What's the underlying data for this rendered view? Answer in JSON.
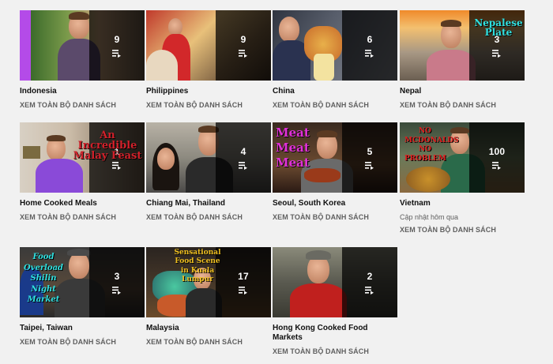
{
  "playlists": [
    {
      "title": "Indonesia",
      "count": "9",
      "action": "XEM TOÀN BỘ DANH SÁCH"
    },
    {
      "title": "Philippines",
      "count": "9",
      "action": "XEM TOÀN BỘ DANH SÁCH"
    },
    {
      "title": "China",
      "count": "6",
      "action": "XEM TOÀN BỘ DANH SÁCH"
    },
    {
      "title": "Nepal",
      "count": "3",
      "action": "XEM TOÀN BỘ DANH SÁCH",
      "overlay_text": "Nepalese Plate"
    },
    {
      "title": "Home Cooked Meals",
      "count": "1",
      "action": "XEM TOÀN BỘ DANH SÁCH",
      "overlay_text": "An Incredible Malay Feast"
    },
    {
      "title": "Chiang Mai, Thailand",
      "count": "4",
      "action": "XEM TOÀN BỘ DANH SÁCH"
    },
    {
      "title": "Seoul, South Korea",
      "count": "5",
      "action": "XEM TOÀN BỘ DANH SÁCH",
      "overlay_text": "Meat Meat Meat"
    },
    {
      "title": "Vietnam",
      "count": "100",
      "subtitle": "Cập nhật hôm qua",
      "action": "XEM TOÀN BỘ DANH SÁCH",
      "overlay_text": "NO MCDONALDS NO PROBLEM"
    },
    {
      "title": "Taipei, Taiwan",
      "count": "3",
      "action": "XEM TOÀN BỘ DANH SÁCH",
      "overlay_text": "Food Overload Shilin Night Market"
    },
    {
      "title": "Malaysia",
      "count": "17",
      "action": "XEM TOÀN BỘ DANH SÁCH",
      "overlay_text": "Sensational Food Scene in Kuala Lumpur"
    },
    {
      "title": "Hong Kong Cooked Food Markets",
      "count": "2",
      "action": "XEM TOÀN BỘ DANH SÁCH"
    }
  ],
  "icons": {
    "playlist": "playlist-play-icon"
  },
  "colors": {
    "overlay": "#000000",
    "title": "#111111",
    "secondary": "#606060",
    "background": "#f1f1f1"
  }
}
